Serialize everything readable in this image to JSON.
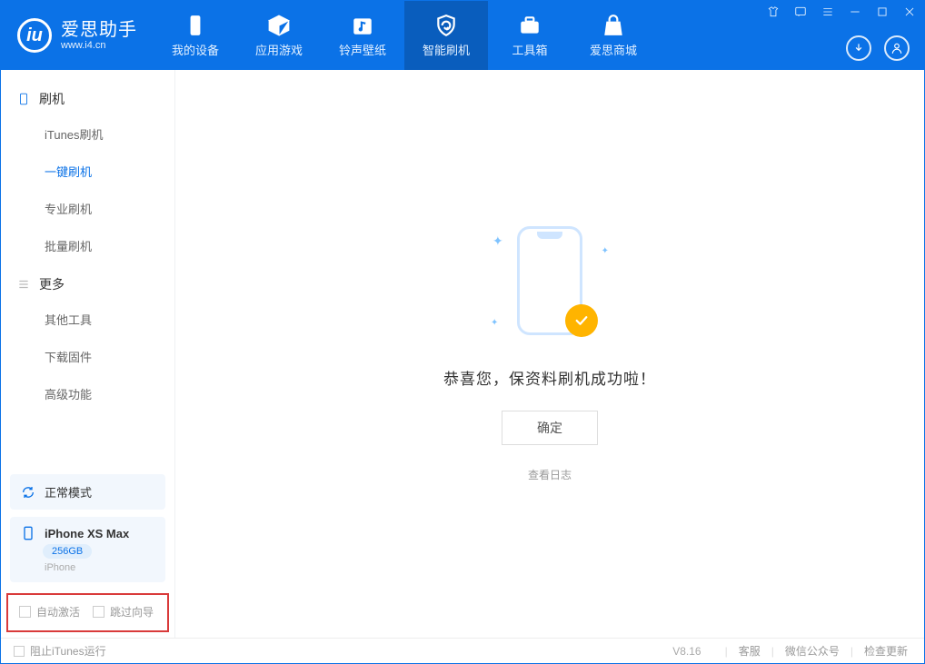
{
  "app": {
    "title": "爱思助手",
    "subtitle": "www.i4.cn"
  },
  "tabs": {
    "device": "我的设备",
    "apps": "应用游戏",
    "ring": "铃声壁纸",
    "flash": "智能刷机",
    "tools": "工具箱",
    "store": "爱思商城"
  },
  "sidebar": {
    "group1_title": "刷机",
    "items1": {
      "itunes": "iTunes刷机",
      "oneclick": "一键刷机",
      "pro": "专业刷机",
      "batch": "批量刷机"
    },
    "group2_title": "更多",
    "items2": {
      "other": "其他工具",
      "firmware": "下载固件",
      "advanced": "高级功能"
    }
  },
  "device": {
    "mode": "正常模式",
    "name": "iPhone XS Max",
    "storage": "256GB",
    "type": "iPhone"
  },
  "checks": {
    "auto_activate": "自动激活",
    "skip_guide": "跳过向导"
  },
  "main": {
    "success": "恭喜您，保资料刷机成功啦！",
    "ok": "确定",
    "log": "查看日志"
  },
  "footer": {
    "block_itunes": "阻止iTunes运行",
    "version": "V8.16",
    "service": "客服",
    "wechat": "微信公众号",
    "update": "检查更新"
  }
}
